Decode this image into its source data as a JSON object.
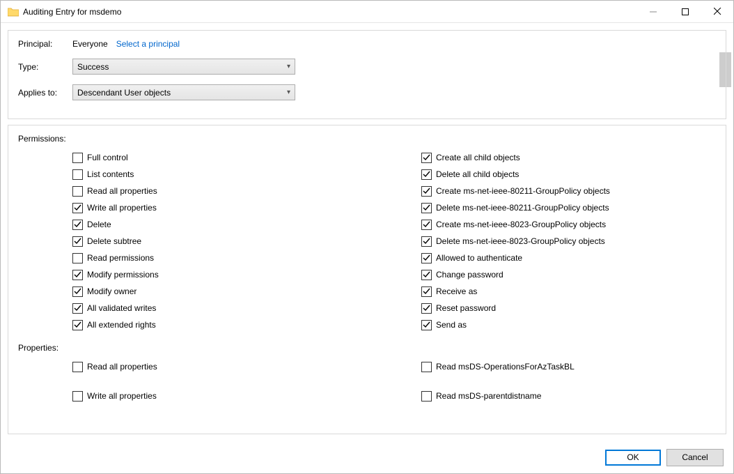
{
  "window": {
    "title": "Auditing Entry for msdemo"
  },
  "top": {
    "principal_label": "Principal:",
    "principal_value": "Everyone",
    "select_principal": "Select a principal",
    "type_label": "Type:",
    "type_value": "Success",
    "applies_label": "Applies to:",
    "applies_value": "Descendant User objects"
  },
  "permissions": {
    "header": "Permissions:",
    "left": [
      {
        "label": "Full control",
        "checked": false
      },
      {
        "label": "List contents",
        "checked": false
      },
      {
        "label": "Read all properties",
        "checked": false
      },
      {
        "label": "Write all properties",
        "checked": true
      },
      {
        "label": "Delete",
        "checked": true
      },
      {
        "label": "Delete subtree",
        "checked": true
      },
      {
        "label": "Read permissions",
        "checked": false
      },
      {
        "label": "Modify permissions",
        "checked": true
      },
      {
        "label": "Modify owner",
        "checked": true
      },
      {
        "label": "All validated writes",
        "checked": true
      },
      {
        "label": "All extended rights",
        "checked": true
      }
    ],
    "right": [
      {
        "label": "Create all child objects",
        "checked": true
      },
      {
        "label": "Delete all child objects",
        "checked": true
      },
      {
        "label": "Create ms-net-ieee-80211-GroupPolicy objects",
        "checked": true
      },
      {
        "label": "Delete ms-net-ieee-80211-GroupPolicy objects",
        "checked": true
      },
      {
        "label": "Create ms-net-ieee-8023-GroupPolicy objects",
        "checked": true
      },
      {
        "label": "Delete ms-net-ieee-8023-GroupPolicy objects",
        "checked": true
      },
      {
        "label": "Allowed to authenticate",
        "checked": true
      },
      {
        "label": "Change password",
        "checked": true
      },
      {
        "label": "Receive as",
        "checked": true
      },
      {
        "label": "Reset password",
        "checked": true
      },
      {
        "label": "Send as",
        "checked": true
      }
    ]
  },
  "properties": {
    "header": "Properties:",
    "left": [
      {
        "label": "Read all properties",
        "checked": false
      },
      {
        "label": "Write all properties",
        "checked": false
      }
    ],
    "right": [
      {
        "label": "Read msDS-OperationsForAzTaskBL",
        "checked": false
      },
      {
        "label": "Read msDS-parentdistname",
        "checked": false
      }
    ]
  },
  "footer": {
    "ok": "OK",
    "cancel": "Cancel"
  }
}
